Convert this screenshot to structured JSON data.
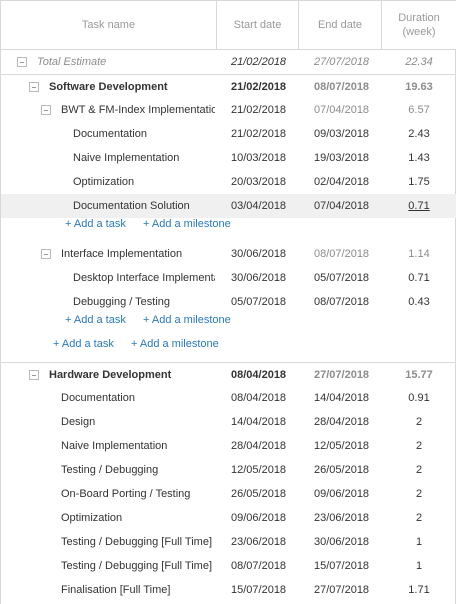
{
  "header": {
    "task_name": "Task name",
    "start_date": "Start date",
    "end_date": "End date",
    "duration": "Duration",
    "duration_unit": "(week)"
  },
  "rows": [
    {
      "name": "Total Estimate",
      "start": "21/02/2018",
      "end": "27/07/2018",
      "duration": "22.34"
    },
    {
      "name": "Software Development",
      "start": "21/02/2018",
      "end": "08/07/2018",
      "duration": "19.63"
    },
    {
      "name": "BWT & FM-Index Implementation",
      "start": "21/02/2018",
      "end": "07/04/2018",
      "duration": "6.57"
    },
    {
      "name": "Documentation",
      "start": "21/02/2018",
      "end": "09/03/2018",
      "duration": "2.43"
    },
    {
      "name": "Naive Implementation",
      "start": "10/03/2018",
      "end": "19/03/2018",
      "duration": "1.43"
    },
    {
      "name": "Optimization",
      "start": "20/03/2018",
      "end": "02/04/2018",
      "duration": "1.75"
    },
    {
      "name": "Documentation Solution",
      "start": "03/04/2018",
      "end": "07/04/2018",
      "duration": "0.71"
    },
    {
      "add_task": "+ Add a task",
      "add_milestone": "+ Add a milestone"
    },
    {
      "name": "Interface Implementation",
      "start": "30/06/2018",
      "end": "08/07/2018",
      "duration": "1.14"
    },
    {
      "name": "Desktop Interface Implementati",
      "start": "30/06/2018",
      "end": "05/07/2018",
      "duration": "0.71"
    },
    {
      "name": "Debugging / Testing",
      "start": "05/07/2018",
      "end": "08/07/2018",
      "duration": "0.43"
    },
    {
      "add_task": "+ Add a task",
      "add_milestone": "+ Add a milestone"
    },
    {
      "add_task": "+ Add a task",
      "add_milestone": "+ Add a milestone"
    },
    {
      "name": "Hardware Development",
      "start": "08/04/2018",
      "end": "27/07/2018",
      "duration": "15.77"
    },
    {
      "name": "Documentation",
      "start": "08/04/2018",
      "end": "14/04/2018",
      "duration": "0.91"
    },
    {
      "name": "Design",
      "start": "14/04/2018",
      "end": "28/04/2018",
      "duration": "2"
    },
    {
      "name": "Naive Implementation",
      "start": "28/04/2018",
      "end": "12/05/2018",
      "duration": "2"
    },
    {
      "name": "Testing / Debugging",
      "start": "12/05/2018",
      "end": "26/05/2018",
      "duration": "2"
    },
    {
      "name": "On-Board Porting / Testing",
      "start": "26/05/2018",
      "end": "09/06/2018",
      "duration": "2"
    },
    {
      "name": "Optimization",
      "start": "09/06/2018",
      "end": "23/06/2018",
      "duration": "2"
    },
    {
      "name": "Testing / Debugging [Full Time]",
      "start": "23/06/2018",
      "end": "30/06/2018",
      "duration": "1"
    },
    {
      "name": "Testing / Debugging [Full Time]",
      "start": "08/07/2018",
      "end": "15/07/2018",
      "duration": "1"
    },
    {
      "name": "Finalisation [Full Time]",
      "start": "15/07/2018",
      "end": "27/07/2018",
      "duration": "1.71"
    }
  ]
}
